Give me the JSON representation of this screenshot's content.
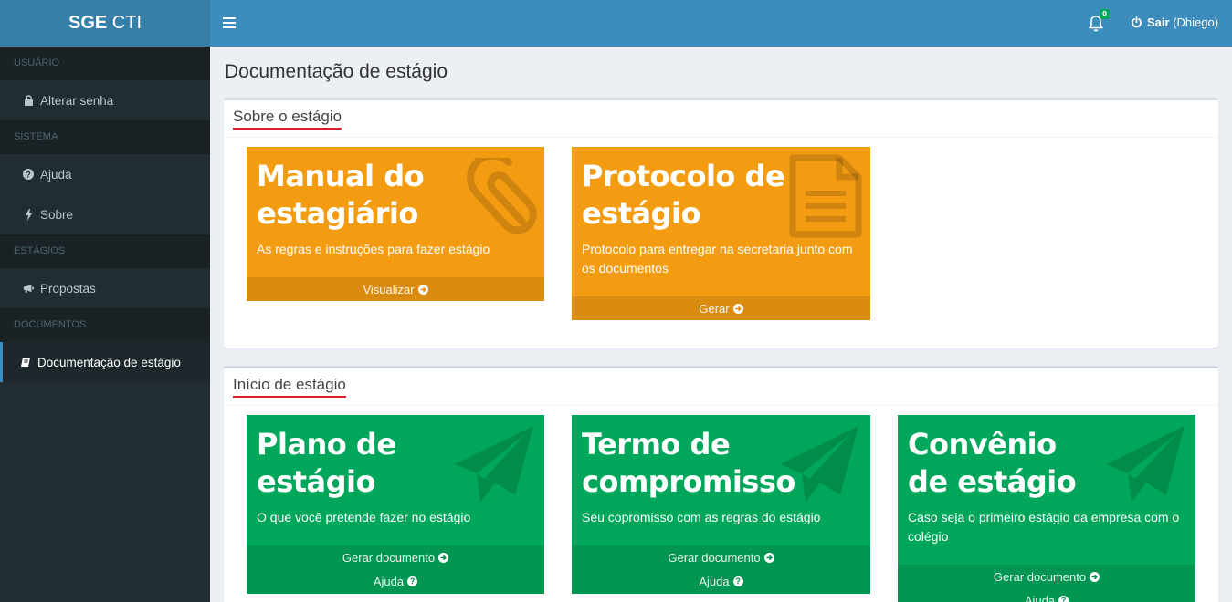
{
  "header": {
    "logo_bold": "SGE",
    "logo_rest": " CTI",
    "notifications_count": "0",
    "logout_label": "Sair",
    "logout_user": "(Dhiego)"
  },
  "sidebar": {
    "sections": [
      {
        "title": "USUÁRIO",
        "items": [
          {
            "label": "Alterar senha",
            "icon": "lock-icon"
          }
        ]
      },
      {
        "title": "SISTEMA",
        "items": [
          {
            "label": "Ajuda",
            "icon": "question-circle-icon"
          },
          {
            "label": "Sobre",
            "icon": "bolt-icon"
          }
        ]
      },
      {
        "title": "ESTÁGIOS",
        "items": [
          {
            "label": "Propostas",
            "icon": "bullhorn-icon"
          }
        ]
      },
      {
        "title": "DOCUMENTOS",
        "items": [
          {
            "label": "Documentação de estágio",
            "icon": "book-icon",
            "active": true
          }
        ]
      }
    ]
  },
  "page": {
    "title": "Documentação de estágio"
  },
  "boxes": [
    {
      "title": "Sobre o estágio",
      "tiles": [
        {
          "title_line1": "Manual do",
          "title_line2": "estagiário",
          "desc": "As regras e instruções para fazer estágio",
          "action": "Visualizar",
          "color": "#f39c12",
          "icon": "paperclip-icon"
        },
        {
          "title_line1": "Protocolo de",
          "title_line2": "estágio",
          "desc": "Protocolo para entregar na secretaria junto com os documentos",
          "action": "Gerar",
          "color": "#f39c12",
          "icon": "file-text-icon"
        }
      ]
    },
    {
      "title": "Início de estágio",
      "tiles": [
        {
          "title_line1": "Plano de",
          "title_line2": "estágio",
          "desc": "O que você pretende fazer no estágio",
          "action": "Gerar documento",
          "help": "Ajuda",
          "color": "#00a65a",
          "icon": "paper-plane-icon"
        },
        {
          "title_line1": "Termo de",
          "title_line2": "compromisso",
          "desc": "Seu copromisso com as regras do estágio",
          "action": "Gerar documento",
          "help": "Ajuda",
          "color": "#00a65a",
          "icon": "paper-plane-icon"
        },
        {
          "title_line1": "Convênio",
          "title_line2": "de estágio",
          "desc": "Caso seja o primeiro estágio da empresa com o colégio",
          "action": "Gerar documento",
          "help": "Ajuda",
          "color": "#00a65a",
          "icon": "paper-plane-icon"
        }
      ]
    }
  ],
  "colors": {
    "header": "#3c8dbc",
    "logo_bg": "#367fa9",
    "sidebar": "#222d32",
    "orange": "#f39c12",
    "green": "#00a65a",
    "underline": "#dd1f26"
  }
}
